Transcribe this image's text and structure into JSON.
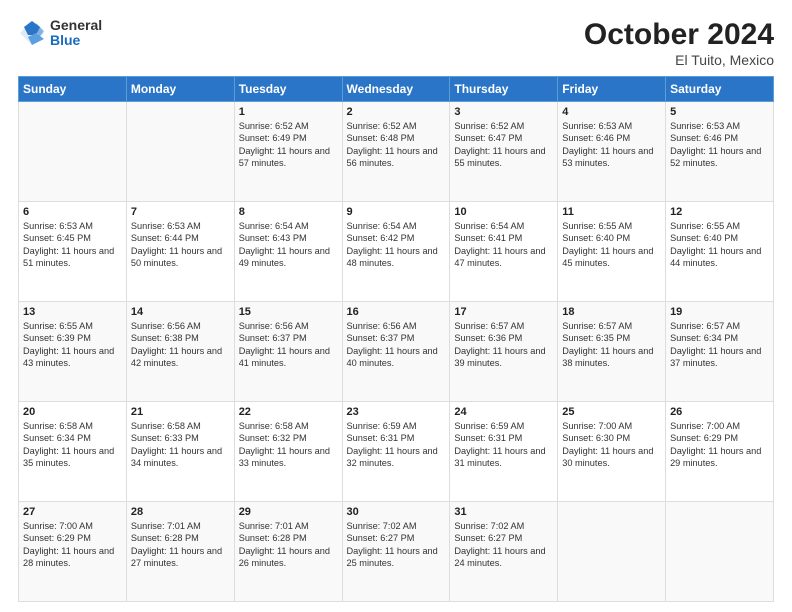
{
  "logo": {
    "general": "General",
    "blue": "Blue"
  },
  "title": {
    "month_year": "October 2024",
    "location": "El Tuito, Mexico"
  },
  "weekdays": [
    "Sunday",
    "Monday",
    "Tuesday",
    "Wednesday",
    "Thursday",
    "Friday",
    "Saturday"
  ],
  "weeks": [
    [
      {
        "day": "",
        "info": ""
      },
      {
        "day": "",
        "info": ""
      },
      {
        "day": "1",
        "info": "Sunrise: 6:52 AM\nSunset: 6:49 PM\nDaylight: 11 hours and 57 minutes."
      },
      {
        "day": "2",
        "info": "Sunrise: 6:52 AM\nSunset: 6:48 PM\nDaylight: 11 hours and 56 minutes."
      },
      {
        "day": "3",
        "info": "Sunrise: 6:52 AM\nSunset: 6:47 PM\nDaylight: 11 hours and 55 minutes."
      },
      {
        "day": "4",
        "info": "Sunrise: 6:53 AM\nSunset: 6:46 PM\nDaylight: 11 hours and 53 minutes."
      },
      {
        "day": "5",
        "info": "Sunrise: 6:53 AM\nSunset: 6:46 PM\nDaylight: 11 hours and 52 minutes."
      }
    ],
    [
      {
        "day": "6",
        "info": "Sunrise: 6:53 AM\nSunset: 6:45 PM\nDaylight: 11 hours and 51 minutes."
      },
      {
        "day": "7",
        "info": "Sunrise: 6:53 AM\nSunset: 6:44 PM\nDaylight: 11 hours and 50 minutes."
      },
      {
        "day": "8",
        "info": "Sunrise: 6:54 AM\nSunset: 6:43 PM\nDaylight: 11 hours and 49 minutes."
      },
      {
        "day": "9",
        "info": "Sunrise: 6:54 AM\nSunset: 6:42 PM\nDaylight: 11 hours and 48 minutes."
      },
      {
        "day": "10",
        "info": "Sunrise: 6:54 AM\nSunset: 6:41 PM\nDaylight: 11 hours and 47 minutes."
      },
      {
        "day": "11",
        "info": "Sunrise: 6:55 AM\nSunset: 6:40 PM\nDaylight: 11 hours and 45 minutes."
      },
      {
        "day": "12",
        "info": "Sunrise: 6:55 AM\nSunset: 6:40 PM\nDaylight: 11 hours and 44 minutes."
      }
    ],
    [
      {
        "day": "13",
        "info": "Sunrise: 6:55 AM\nSunset: 6:39 PM\nDaylight: 11 hours and 43 minutes."
      },
      {
        "day": "14",
        "info": "Sunrise: 6:56 AM\nSunset: 6:38 PM\nDaylight: 11 hours and 42 minutes."
      },
      {
        "day": "15",
        "info": "Sunrise: 6:56 AM\nSunset: 6:37 PM\nDaylight: 11 hours and 41 minutes."
      },
      {
        "day": "16",
        "info": "Sunrise: 6:56 AM\nSunset: 6:37 PM\nDaylight: 11 hours and 40 minutes."
      },
      {
        "day": "17",
        "info": "Sunrise: 6:57 AM\nSunset: 6:36 PM\nDaylight: 11 hours and 39 minutes."
      },
      {
        "day": "18",
        "info": "Sunrise: 6:57 AM\nSunset: 6:35 PM\nDaylight: 11 hours and 38 minutes."
      },
      {
        "day": "19",
        "info": "Sunrise: 6:57 AM\nSunset: 6:34 PM\nDaylight: 11 hours and 37 minutes."
      }
    ],
    [
      {
        "day": "20",
        "info": "Sunrise: 6:58 AM\nSunset: 6:34 PM\nDaylight: 11 hours and 35 minutes."
      },
      {
        "day": "21",
        "info": "Sunrise: 6:58 AM\nSunset: 6:33 PM\nDaylight: 11 hours and 34 minutes."
      },
      {
        "day": "22",
        "info": "Sunrise: 6:58 AM\nSunset: 6:32 PM\nDaylight: 11 hours and 33 minutes."
      },
      {
        "day": "23",
        "info": "Sunrise: 6:59 AM\nSunset: 6:31 PM\nDaylight: 11 hours and 32 minutes."
      },
      {
        "day": "24",
        "info": "Sunrise: 6:59 AM\nSunset: 6:31 PM\nDaylight: 11 hours and 31 minutes."
      },
      {
        "day": "25",
        "info": "Sunrise: 7:00 AM\nSunset: 6:30 PM\nDaylight: 11 hours and 30 minutes."
      },
      {
        "day": "26",
        "info": "Sunrise: 7:00 AM\nSunset: 6:29 PM\nDaylight: 11 hours and 29 minutes."
      }
    ],
    [
      {
        "day": "27",
        "info": "Sunrise: 7:00 AM\nSunset: 6:29 PM\nDaylight: 11 hours and 28 minutes."
      },
      {
        "day": "28",
        "info": "Sunrise: 7:01 AM\nSunset: 6:28 PM\nDaylight: 11 hours and 27 minutes."
      },
      {
        "day": "29",
        "info": "Sunrise: 7:01 AM\nSunset: 6:28 PM\nDaylight: 11 hours and 26 minutes."
      },
      {
        "day": "30",
        "info": "Sunrise: 7:02 AM\nSunset: 6:27 PM\nDaylight: 11 hours and 25 minutes."
      },
      {
        "day": "31",
        "info": "Sunrise: 7:02 AM\nSunset: 6:27 PM\nDaylight: 11 hours and 24 minutes."
      },
      {
        "day": "",
        "info": ""
      },
      {
        "day": "",
        "info": ""
      }
    ]
  ]
}
